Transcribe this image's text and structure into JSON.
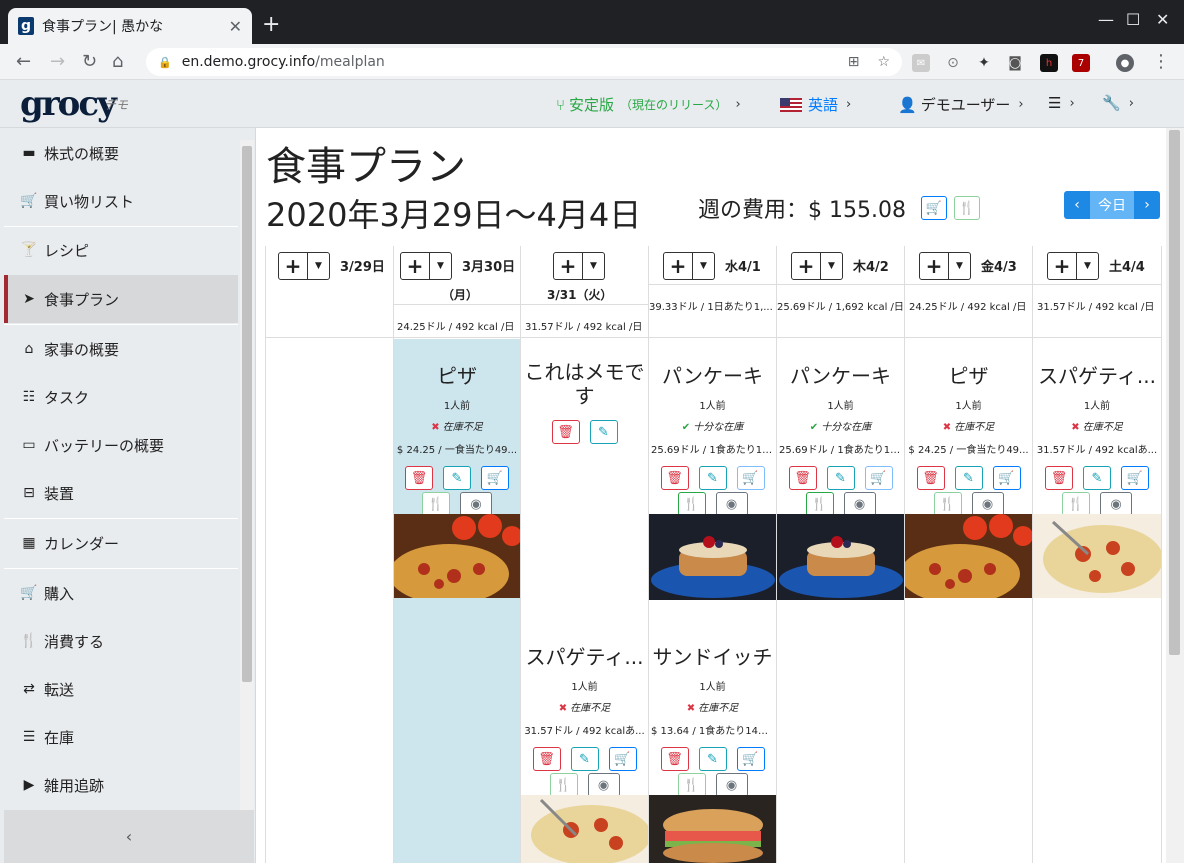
{
  "browser": {
    "tab_title": "食事プラン| 愚かな",
    "favicon_letter": "g",
    "url_host": "en.demo.grocy.info",
    "url_path": "/mealplan",
    "new_tab": "+",
    "ext_badge": "7"
  },
  "topnav": {
    "logo": "grocy",
    "logo_sub": "デモ",
    "release": "安定版",
    "release_sub": "（現在のリリース）",
    "language": "英語",
    "user": "デモユーザー"
  },
  "sidebar": {
    "items": [
      {
        "label": "株式の概要",
        "icon": "box-icon"
      },
      {
        "label": "買い物リスト",
        "icon": "cart-icon"
      },
      {
        "label": "レシピ",
        "icon": "cocktail-icon"
      },
      {
        "label": "食事プラン",
        "icon": "paper-plane-icon",
        "active": true
      },
      {
        "label": "家事の概要",
        "icon": "home-icon"
      },
      {
        "label": "タスク",
        "icon": "tasks-icon"
      },
      {
        "label": "バッテリーの概要",
        "icon": "battery-icon"
      },
      {
        "label": "装置",
        "icon": "toolbox-icon"
      },
      {
        "label": "カレンダー",
        "icon": "calendar-icon"
      },
      {
        "label": "購入",
        "icon": "cart-icon"
      },
      {
        "label": "消費する",
        "icon": "utensils-icon"
      },
      {
        "label": "転送",
        "icon": "exchange-icon"
      },
      {
        "label": "在庫",
        "icon": "list-icon"
      },
      {
        "label": "雑用追跡",
        "icon": "play-icon"
      }
    ]
  },
  "page": {
    "title": "食事プラン",
    "week_range": "2020年3月29日〜4月4日",
    "week_cost_label": "週の費用：",
    "week_cost_value": "$ 155.08",
    "today_label": "今日"
  },
  "days": [
    {
      "label": "3/29日",
      "sub1": "",
      "summary": ""
    },
    {
      "label": "3月30日",
      "sub1": "（月）",
      "summary": "24.25ドル / 492 kcal /日"
    },
    {
      "label": "",
      "sub1": "3/31（火）",
      "summary": "31.57ドル / 492 kcal /日"
    },
    {
      "label": "水4/1",
      "sub1": "",
      "summary": "39.33ドル / 1日あたり1,..."
    },
    {
      "label": "木4/2",
      "sub1": "",
      "summary": "25.69ドル / 1,692 kcal /日"
    },
    {
      "label": "金4/3",
      "sub1": "",
      "summary": "24.25ドル / 492 kcal /日"
    },
    {
      "label": "土4/4",
      "sub1": "",
      "summary": "31.57ドル / 492 kcal /日"
    }
  ],
  "meals": {
    "mon": {
      "title": "ピザ",
      "servings": "1人前",
      "stock": "在庫不足",
      "price": "$ 24.25 / 一食当たり49..."
    },
    "tue_note": {
      "title": "これはメモです"
    },
    "wed": {
      "title": "パンケーキ",
      "servings": "1人前",
      "stock": "十分な在庫",
      "price": "25.69ドル / 1食あたり1,..."
    },
    "thu": {
      "title": "パンケーキ",
      "servings": "1人前",
      "stock": "十分な在庫",
      "price": "25.69ドル / 1食あたり1,..."
    },
    "fri": {
      "title": "ピザ",
      "servings": "1人前",
      "stock": "在庫不足",
      "price": "$ 24.25 / 一食当たり49..."
    },
    "sat": {
      "title": "スパゲティ...",
      "servings": "1人前",
      "stock": "在庫不足",
      "price": "31.57ドル / 492 kcalあ..."
    },
    "tue2": {
      "title": "スパゲティ...",
      "servings": "1人前",
      "stock": "在庫不足",
      "price": "31.57ドル / 492 kcalあ..."
    },
    "wed2": {
      "title": "サンドイッチ",
      "servings": "1人前",
      "stock": "在庫不足",
      "price": "$ 13.64 / 1食あたり147...."
    }
  },
  "colors": {
    "accent": "#1e88e5",
    "danger": "#dc3545",
    "success": "#28a745",
    "today_highlight": "#cde6ee",
    "sidebar_active_border": "#a12a33"
  }
}
